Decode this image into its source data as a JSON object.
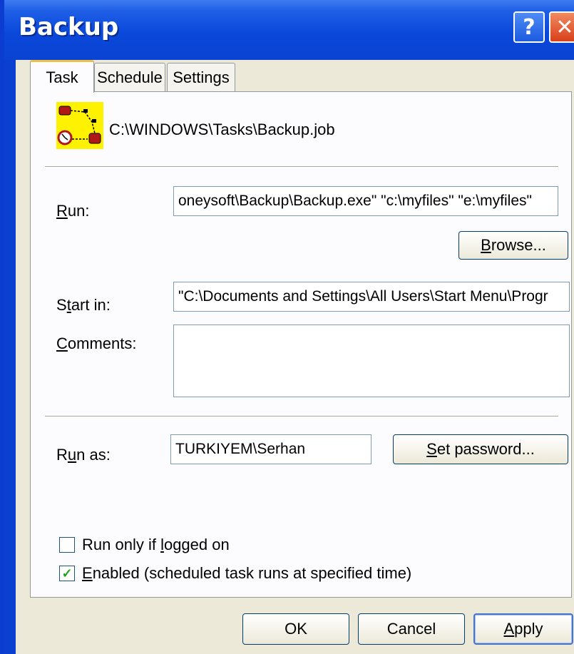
{
  "window": {
    "title": "Backup",
    "help_label": "?",
    "close_label": "✕"
  },
  "tabs": [
    {
      "label": "Task"
    },
    {
      "label": "Schedule"
    },
    {
      "label": "Settings"
    }
  ],
  "task": {
    "job_path": "C:\\WINDOWS\\Tasks\\Backup.job",
    "run_label_accel": "R",
    "run_label_rest": "un:",
    "run_value": "oneysoft\\Backup\\Backup.exe\" \"c:\\myfiles\" \"e:\\myfiles\"",
    "browse_accel": "B",
    "browse_rest": "rowse...",
    "start_in_label_pre": "S",
    "start_in_label_accel": "t",
    "start_in_label_rest": "art in:",
    "start_in_value": "\"C:\\Documents and Settings\\All Users\\Start Menu\\Progr",
    "comments_label_accel": "C",
    "comments_label_rest": "omments:",
    "comments_value": "",
    "run_as_label_pre": "R",
    "run_as_label_accel": "u",
    "run_as_label_rest": "n as:",
    "run_as_value": "TURKIYEM\\Serhan",
    "set_password_accel": "S",
    "set_password_rest": "et password...",
    "run_only_logged_pre": "Run only if ",
    "run_only_logged_accel": "l",
    "run_only_logged_rest": "ogged on",
    "run_only_logged_checked": false,
    "enabled_accel": "E",
    "enabled_rest": "nabled (scheduled task runs at specified time)",
    "enabled_checked": true,
    "check_mark": "✓"
  },
  "footer": {
    "ok_label": "OK",
    "cancel_label": "Cancel",
    "apply_accel": "A",
    "apply_rest": "pply"
  },
  "colors": {
    "titlebar": "#0a48da",
    "face": "#ece9d8",
    "tab_highlight": "#f0c040",
    "checkmark": "#21a121"
  },
  "icons": [
    "help-icon",
    "close-icon",
    "task-scheduler-icon",
    "checkmark-icon"
  ]
}
